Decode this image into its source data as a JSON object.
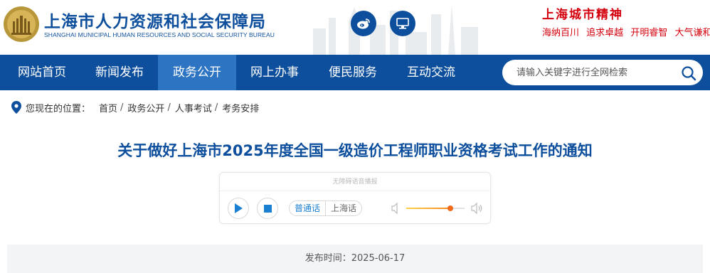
{
  "header": {
    "title": "上海市人力资源和社会保障局",
    "subtitle": "SHANGHAI MUNICIPAL HUMAN RESOURCES AND SOCIAL SECURITY BUREAU",
    "weibo_icon": "weibo-icon",
    "mobile_icon": "computer-monitor-icon",
    "spirit": {
      "title": "上海城市精神",
      "phrases": [
        "海纳百川",
        "追求卓越",
        "开明睿智",
        "大气谦和"
      ]
    }
  },
  "nav": {
    "items": [
      {
        "label": "网站首页"
      },
      {
        "label": "新闻发布"
      },
      {
        "label": "政务公开"
      },
      {
        "label": "网上办事"
      },
      {
        "label": "便民服务"
      },
      {
        "label": "互动交流"
      }
    ],
    "active_label": "政务公开",
    "search": {
      "placeholder": "请输入关键字进行全网检索",
      "icon": "search-icon"
    }
  },
  "breadcrumb": {
    "prefix": "您现在的位置：",
    "items": [
      "首页",
      "政务公开",
      "人事考试",
      "考务安排"
    ],
    "separator": "/"
  },
  "article": {
    "title": "关于做好上海市2025年度全国一级造价工程师职业资格考试工作的通知",
    "player": {
      "header": "无障碍语音播报",
      "languages": [
        "普通话",
        "上海话"
      ],
      "active_language": "普通话",
      "volume": 0.75
    },
    "publish_label": "发布时间：",
    "publish_date": "2025-06-17"
  },
  "colors": {
    "brand": "#0d4f9c",
    "nav_active": "#2d74c2",
    "spirit_red": "#d4000d",
    "volume_fill": "#f06a1a"
  }
}
